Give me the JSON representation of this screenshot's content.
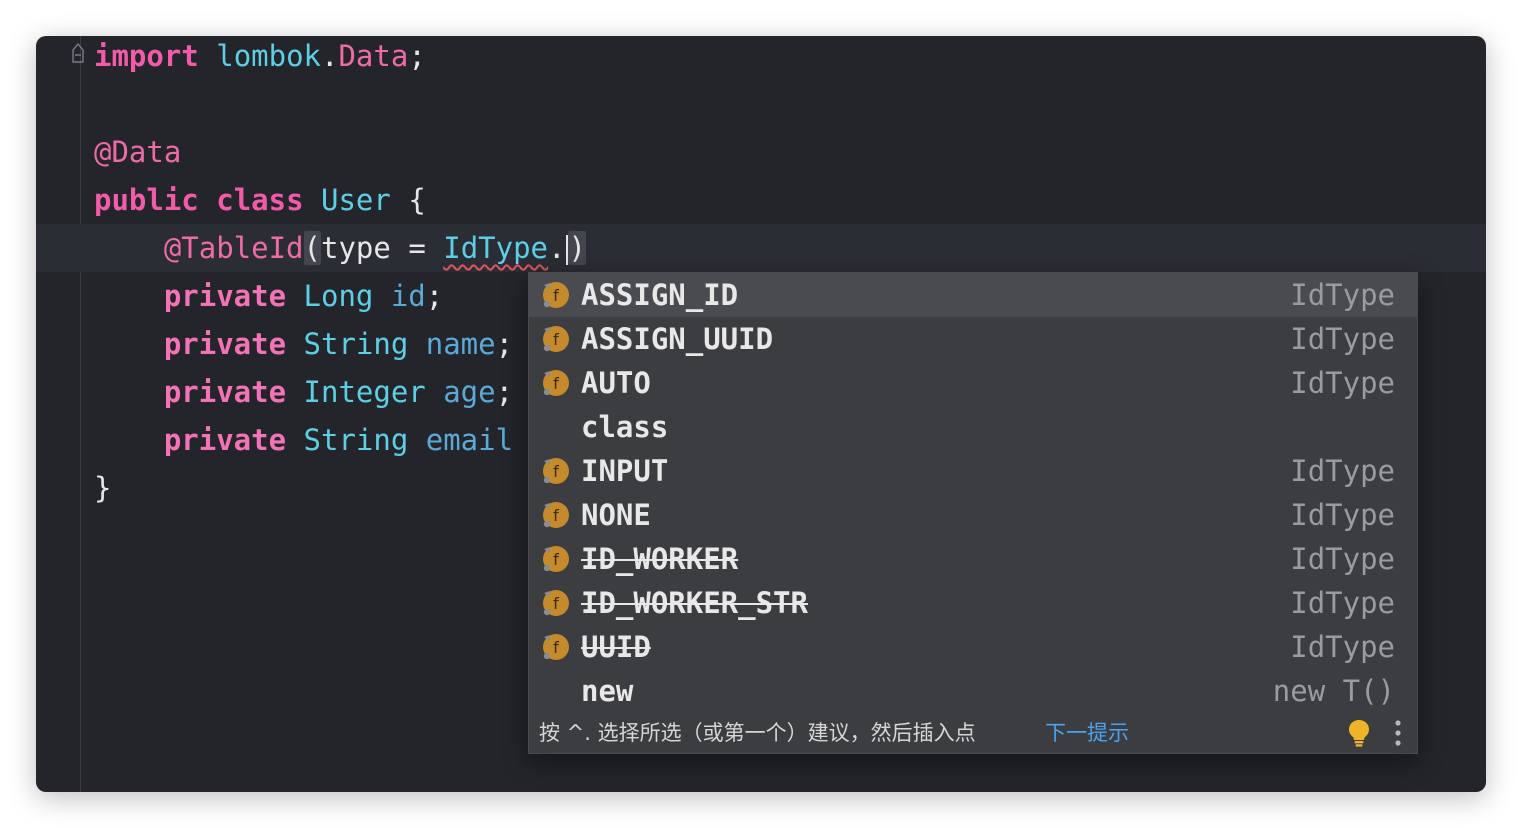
{
  "code": {
    "line1": {
      "kw": "import",
      "pkg": "lombok",
      "dot": ".",
      "cls": "Data",
      "semi": ";"
    },
    "line3": {
      "ann": "@Data"
    },
    "line4": {
      "kw1": "public",
      "kw2": "class",
      "name": "User",
      "brace": "{"
    },
    "line5": {
      "ann": "@TableId",
      "open": "(",
      "param": "type",
      "eq": "=",
      "type": "IdType",
      "dot": ".",
      "close": ")"
    },
    "line6": {
      "kw": "private",
      "type": "Long",
      "field": "id",
      "semi": ";"
    },
    "line7": {
      "kw": "private",
      "type": "String",
      "field": "name",
      "semi": ";"
    },
    "line8": {
      "kw": "private",
      "type": "Integer",
      "field": "age",
      "semi": ";"
    },
    "line9": {
      "kw": "private",
      "type": "String",
      "field": "email"
    },
    "line10": {
      "brace": "}"
    }
  },
  "completion": {
    "items": [
      {
        "label": "ASSIGN_ID",
        "type": "IdType",
        "icon": "field-icon",
        "deprecated": false,
        "selected": true
      },
      {
        "label": "ASSIGN_UUID",
        "type": "IdType",
        "icon": "field-icon",
        "deprecated": false,
        "selected": false
      },
      {
        "label": "AUTO",
        "type": "IdType",
        "icon": "field-icon",
        "deprecated": false,
        "selected": false
      },
      {
        "label": "class",
        "type": "",
        "icon": "",
        "deprecated": false,
        "selected": false
      },
      {
        "label": "INPUT",
        "type": "IdType",
        "icon": "field-icon",
        "deprecated": false,
        "selected": false
      },
      {
        "label": "NONE",
        "type": "IdType",
        "icon": "field-icon",
        "deprecated": false,
        "selected": false
      },
      {
        "label": "ID_WORKER",
        "type": "IdType",
        "icon": "field-icon",
        "deprecated": true,
        "selected": false
      },
      {
        "label": "ID_WORKER_STR",
        "type": "IdType",
        "icon": "field-icon",
        "deprecated": true,
        "selected": false
      },
      {
        "label": "UUID",
        "type": "IdType",
        "icon": "field-icon",
        "deprecated": true,
        "selected": false
      },
      {
        "label": "new",
        "type": "new T()",
        "icon": "",
        "deprecated": false,
        "selected": false
      }
    ],
    "footer": {
      "hint": "按 ^. 选择所选（或第一个）建议，然后插入点",
      "link": "下一提示"
    }
  },
  "colors": {
    "editor_bg": "#24252b",
    "keyword": "#f472b6",
    "type": "#5ccfe6",
    "field_icon": "#c58a2b",
    "link": "#4aa3f0",
    "bulb": "#f0b429"
  }
}
